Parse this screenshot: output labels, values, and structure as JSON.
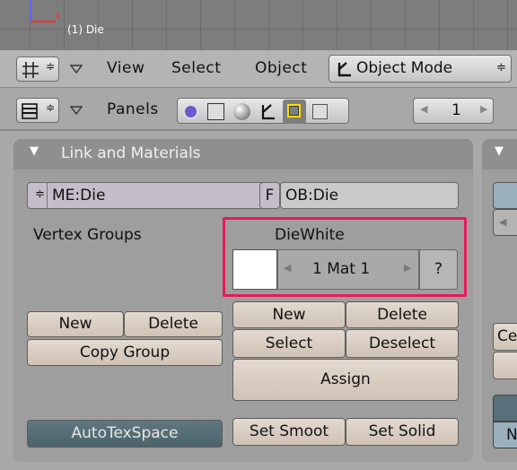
{
  "viewport": {
    "title": "(1) Die"
  },
  "header1": {
    "view": "View",
    "select": "Select",
    "object": "Object",
    "mode": "Object Mode"
  },
  "header2": {
    "panels": "Panels",
    "layer": "1"
  },
  "link_panel": {
    "title": "Link and Materials",
    "mesh": "ME:Die",
    "f": "F",
    "object": "OB:Die",
    "vertex_groups": "Vertex Groups",
    "material_name": "DieWhite",
    "mat_index": "1 Mat 1",
    "question": "?"
  },
  "vg_buttons": {
    "new": "New",
    "delete": "Delete",
    "copy": "Copy Group"
  },
  "mat_buttons": {
    "new": "New",
    "delete": "Delete",
    "select": "Select",
    "deselect": "Deselect",
    "assign": "Assign"
  },
  "bottom": {
    "autotex": "AutoTexSpace",
    "smooth": "Set Smoot",
    "solid": "Set Solid"
  },
  "right_panel": {
    "ce": "Ce",
    "n": "N"
  },
  "colors": {
    "highlight": "#e8195a",
    "material_swatch": "#ffffff"
  }
}
